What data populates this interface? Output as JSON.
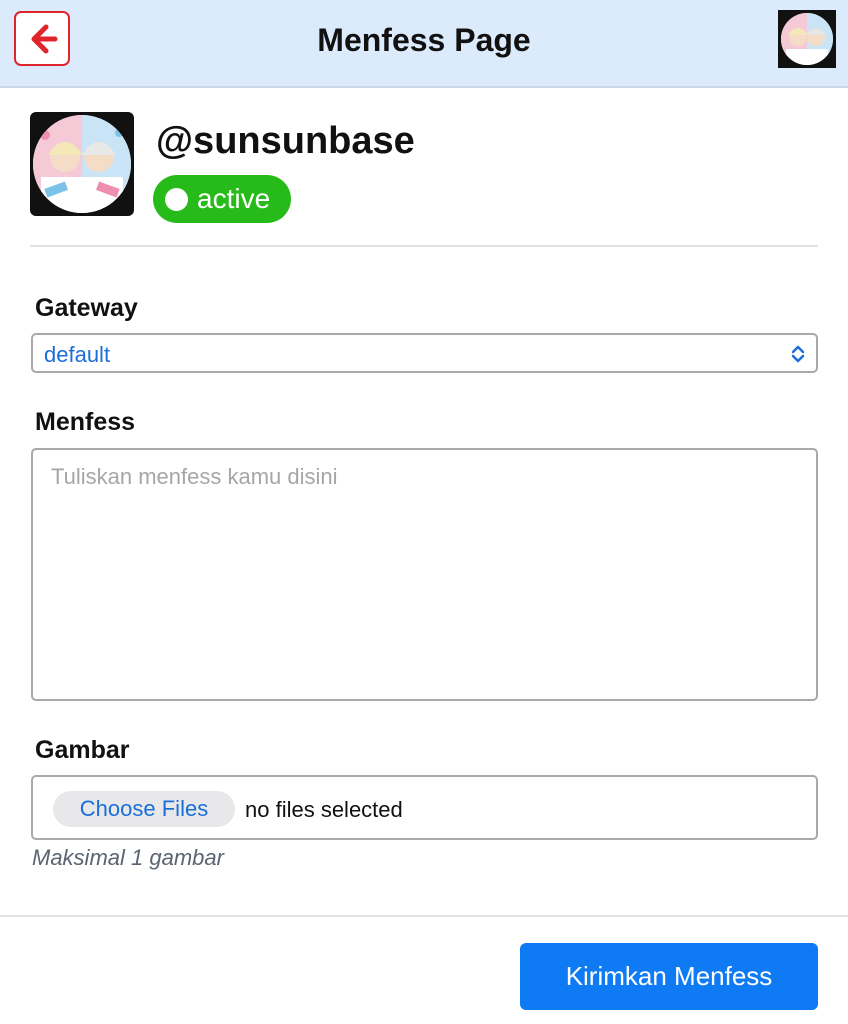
{
  "header": {
    "title": "Menfess Page",
    "back_icon": "arrow-left-icon",
    "accent_color": "#e0242b",
    "background_color": "#dcebfb"
  },
  "profile": {
    "username": "@sunsunbase",
    "status": "active",
    "status_color": "#27bb1a"
  },
  "form": {
    "gateway": {
      "label": "Gateway",
      "selected": "default"
    },
    "menfess": {
      "label": "Menfess",
      "placeholder": "Tuliskan menfess kamu disini"
    },
    "gambar": {
      "label": "Gambar",
      "button_label": "Choose Files",
      "file_status": "no files selected",
      "hint": "Maksimal 1 gambar"
    }
  },
  "submit": {
    "label": "Kirimkan Menfess",
    "color": "#0e7bf4"
  }
}
